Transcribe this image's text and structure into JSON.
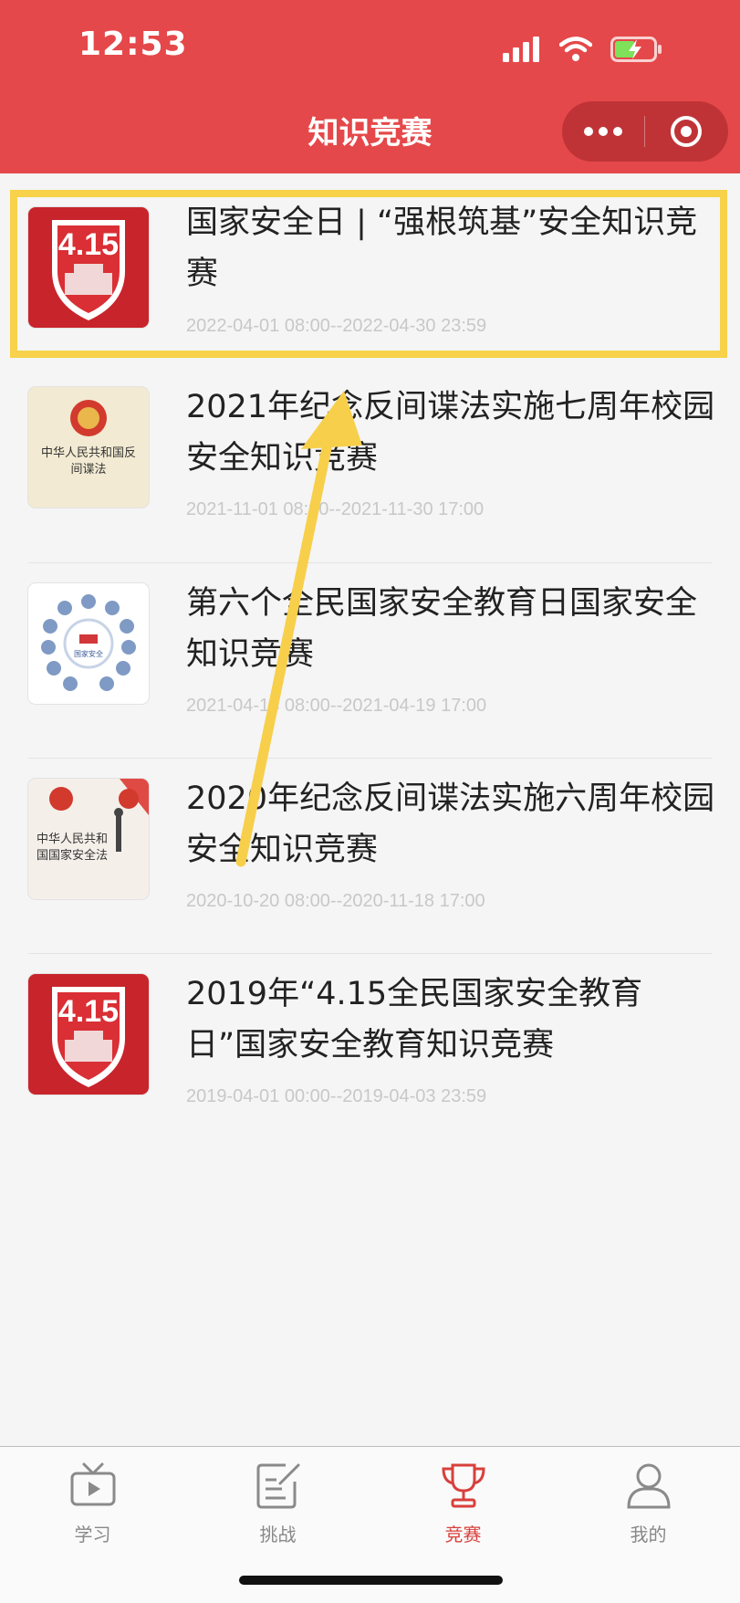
{
  "status_bar": {
    "time": "12:53"
  },
  "nav": {
    "title": "知识竞赛"
  },
  "competitions": [
    {
      "title": "国家安全日 | “强根筑基”安全知识竞赛",
      "date": "2022-04-01 08:00--2022-04-30 23:59",
      "thumb_text": "4.15"
    },
    {
      "title": "2021年纪念反间谍法实施七周年校园安全知识竞赛",
      "date": "2021-11-01 08:00--2021-11-30 17:00",
      "thumb_text": "中华人民共和国反间谍法"
    },
    {
      "title": "第六个全民国家安全教育日国家安全知识竞赛",
      "date": "2021-04-13 08:00--2021-04-19 17:00",
      "thumb_text": "国家安全"
    },
    {
      "title": "2020年纪念反间谍法实施六周年校园安全知识竞赛",
      "date": "2020-10-20 08:00--2020-11-18 17:00",
      "thumb_text": "中华人民共和国国家安全法"
    },
    {
      "title": "2019年“4.15全民国家安全教育日”国家安全教育知识竞赛",
      "date": "2019-04-01 00:00--2019-04-03 23:59",
      "thumb_text": "4.15"
    }
  ],
  "tabbar": {
    "tabs": [
      {
        "label": "学习",
        "icon": "video-icon"
      },
      {
        "label": "挑战",
        "icon": "edit-icon"
      },
      {
        "label": "竞赛",
        "icon": "trophy-icon",
        "active": true
      },
      {
        "label": "我的",
        "icon": "profile-icon"
      }
    ]
  },
  "colors": {
    "header": "#e5484a",
    "active_tab": "#d8403c",
    "highlight": "#f7d24a"
  }
}
